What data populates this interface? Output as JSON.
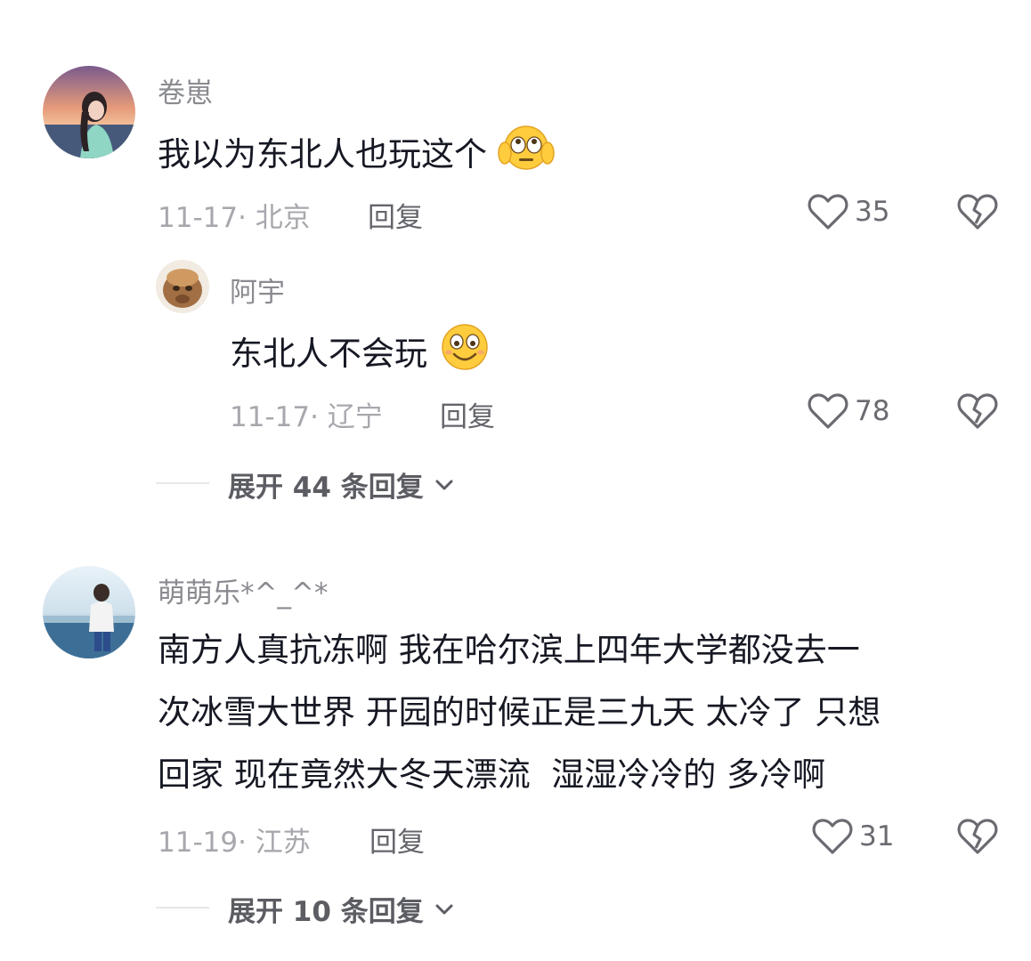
{
  "comments": [
    {
      "username": "卷崽",
      "text": "我以为东北人也玩这个",
      "emoji": "flushed-face-covering-ears-emoji",
      "date": "11-17",
      "location": "· 北京",
      "reply_label": "回复",
      "likes": "35",
      "sub_reply": {
        "username": "阿宇",
        "text": "东北人不会玩",
        "emoji": "smiling-face-emoji",
        "date": "11-17",
        "location": "· 辽宁",
        "reply_label": "回复",
        "likes": "78"
      },
      "expand_label": "展开 44 条回复"
    },
    {
      "username": "萌萌乐*^_^*",
      "text_lines": [
        "南方人真抗冻啊 我在哈尔滨上四年大学都没去一",
        "次冰雪大世界 开园的时候正是三九天 太冷了 只想",
        "回家 现在竟然大冬天漂流  湿湿冷冷的 多冷啊"
      ],
      "date": "11-19",
      "location": "· 江苏",
      "reply_label": "回复",
      "likes": "31",
      "expand_label": "展开 10 条回复"
    }
  ],
  "icons": {
    "like": "heart-outline-icon",
    "dislike": "broken-heart-icon",
    "expand": "chevron-down-icon"
  }
}
